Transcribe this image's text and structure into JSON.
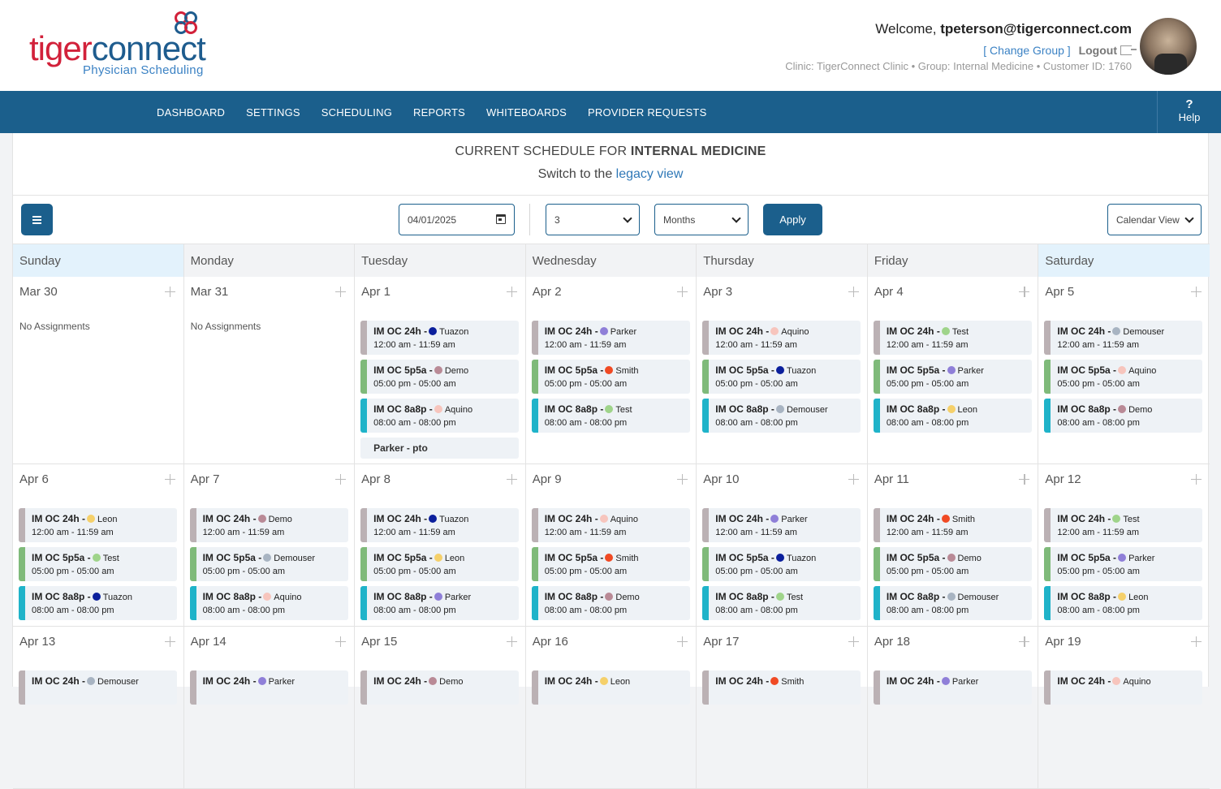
{
  "header": {
    "logo_part1": "tiger",
    "logo_part2": "connect",
    "logo_sub": "Physician Scheduling",
    "welcome_prefix": "Welcome,",
    "user_email": "tpeterson@tigerconnect.com",
    "change_group": "[ Change Group ]",
    "logout": "Logout",
    "clinic_info": "Clinic: TigerConnect Clinic • Group: Internal Medicine • Customer ID: 1760"
  },
  "nav": {
    "items": [
      "DASHBOARD",
      "SETTINGS",
      "SCHEDULING",
      "REPORTS",
      "WHITEBOARDS",
      "PROVIDER REQUESTS"
    ],
    "help_icon": "?",
    "help_label": "Help"
  },
  "page": {
    "title_prefix": "CURRENT SCHEDULE FOR ",
    "title_group": "INTERNAL MEDICINE",
    "switch_prefix": "Switch to the ",
    "switch_link": "legacy view"
  },
  "toolbar": {
    "date_value": "04/01/2025",
    "count_value": "3",
    "unit_value": "Months",
    "apply_label": "Apply",
    "view_value": "Calendar View"
  },
  "colors": {
    "nav": "#1b5f8c",
    "shift24": "#bbb1b4",
    "shift5": "#7fba7a",
    "shift8": "#1fb3c9",
    "Tuazon": "#0b1f9c",
    "Demo": "#b98a96",
    "Aquino": "#f7c5bd",
    "Parker": "#8f7fd8",
    "Smith": "#f04a24",
    "Test": "#9fd48a",
    "Demouser": "#a8b4c2",
    "Leon": "#f5d06a"
  },
  "weekdays": [
    "Sunday",
    "Monday",
    "Tuesday",
    "Wednesday",
    "Thursday",
    "Friday",
    "Saturday"
  ],
  "no_assignments": "No Assignments",
  "weeks": [
    [
      {
        "label": "Mar 30",
        "shifts": []
      },
      {
        "label": "Mar 31",
        "shifts": []
      },
      {
        "label": "Apr 1",
        "shifts": [
          {
            "type": "24",
            "name": "IM OC 24h -",
            "person": "Tuazon",
            "time": "12:00 am - 11:59 am"
          },
          {
            "type": "5",
            "name": "IM OC 5p5a -",
            "person": "Demo",
            "time": "05:00 pm - 05:00 am"
          },
          {
            "type": "8",
            "name": "IM OC 8a8p -",
            "person": "Aquino",
            "time": "08:00 am - 08:00 pm"
          }
        ],
        "pto": "Parker - pto"
      },
      {
        "label": "Apr 2",
        "shifts": [
          {
            "type": "24",
            "name": "IM OC 24h -",
            "person": "Parker",
            "time": "12:00 am - 11:59 am"
          },
          {
            "type": "5",
            "name": "IM OC 5p5a -",
            "person": "Smith",
            "time": "05:00 pm - 05:00 am"
          },
          {
            "type": "8",
            "name": "IM OC 8a8p -",
            "person": "Test",
            "time": "08:00 am - 08:00 pm"
          }
        ]
      },
      {
        "label": "Apr 3",
        "shifts": [
          {
            "type": "24",
            "name": "IM OC 24h -",
            "person": "Aquino",
            "time": "12:00 am - 11:59 am"
          },
          {
            "type": "5",
            "name": "IM OC 5p5a -",
            "person": "Tuazon",
            "time": "05:00 pm - 05:00 am"
          },
          {
            "type": "8",
            "name": "IM OC 8a8p -",
            "person": "Demouser",
            "time": "08:00 am - 08:00 pm"
          }
        ]
      },
      {
        "label": "Apr 4",
        "shifts": [
          {
            "type": "24",
            "name": "IM OC 24h -",
            "person": "Test",
            "time": "12:00 am - 11:59 am"
          },
          {
            "type": "5",
            "name": "IM OC 5p5a -",
            "person": "Parker",
            "time": "05:00 pm - 05:00 am"
          },
          {
            "type": "8",
            "name": "IM OC 8a8p -",
            "person": "Leon",
            "time": "08:00 am - 08:00 pm"
          }
        ]
      },
      {
        "label": "Apr 5",
        "shifts": [
          {
            "type": "24",
            "name": "IM OC 24h -",
            "person": "Demouser",
            "time": "12:00 am - 11:59 am"
          },
          {
            "type": "5",
            "name": "IM OC 5p5a -",
            "person": "Aquino",
            "time": "05:00 pm - 05:00 am"
          },
          {
            "type": "8",
            "name": "IM OC 8a8p -",
            "person": "Demo",
            "time": "08:00 am - 08:00 pm"
          }
        ]
      }
    ],
    [
      {
        "label": "Apr 6",
        "shifts": [
          {
            "type": "24",
            "name": "IM OC 24h -",
            "person": "Leon",
            "time": "12:00 am - 11:59 am"
          },
          {
            "type": "5",
            "name": "IM OC 5p5a -",
            "person": "Test",
            "time": "05:00 pm - 05:00 am"
          },
          {
            "type": "8",
            "name": "IM OC 8a8p -",
            "person": "Tuazon",
            "time": "08:00 am - 08:00 pm"
          }
        ]
      },
      {
        "label": "Apr 7",
        "shifts": [
          {
            "type": "24",
            "name": "IM OC 24h -",
            "person": "Demo",
            "time": "12:00 am - 11:59 am"
          },
          {
            "type": "5",
            "name": "IM OC 5p5a -",
            "person": "Demouser",
            "time": "05:00 pm - 05:00 am"
          },
          {
            "type": "8",
            "name": "IM OC 8a8p -",
            "person": "Aquino",
            "time": "08:00 am - 08:00 pm"
          }
        ]
      },
      {
        "label": "Apr 8",
        "shifts": [
          {
            "type": "24",
            "name": "IM OC 24h -",
            "person": "Tuazon",
            "time": "12:00 am - 11:59 am"
          },
          {
            "type": "5",
            "name": "IM OC 5p5a -",
            "person": "Leon",
            "time": "05:00 pm - 05:00 am"
          },
          {
            "type": "8",
            "name": "IM OC 8a8p -",
            "person": "Parker",
            "time": "08:00 am - 08:00 pm"
          }
        ]
      },
      {
        "label": "Apr 9",
        "shifts": [
          {
            "type": "24",
            "name": "IM OC 24h -",
            "person": "Aquino",
            "time": "12:00 am - 11:59 am"
          },
          {
            "type": "5",
            "name": "IM OC 5p5a -",
            "person": "Smith",
            "time": "05:00 pm - 05:00 am"
          },
          {
            "type": "8",
            "name": "IM OC 8a8p -",
            "person": "Demo",
            "time": "08:00 am - 08:00 pm"
          }
        ]
      },
      {
        "label": "Apr 10",
        "shifts": [
          {
            "type": "24",
            "name": "IM OC 24h -",
            "person": "Parker",
            "time": "12:00 am - 11:59 am"
          },
          {
            "type": "5",
            "name": "IM OC 5p5a -",
            "person": "Tuazon",
            "time": "05:00 pm - 05:00 am"
          },
          {
            "type": "8",
            "name": "IM OC 8a8p -",
            "person": "Test",
            "time": "08:00 am - 08:00 pm"
          }
        ]
      },
      {
        "label": "Apr 11",
        "shifts": [
          {
            "type": "24",
            "name": "IM OC 24h -",
            "person": "Smith",
            "time": "12:00 am - 11:59 am"
          },
          {
            "type": "5",
            "name": "IM OC 5p5a -",
            "person": "Demo",
            "time": "05:00 pm - 05:00 am"
          },
          {
            "type": "8",
            "name": "IM OC 8a8p -",
            "person": "Demouser",
            "time": "08:00 am - 08:00 pm"
          }
        ]
      },
      {
        "label": "Apr 12",
        "shifts": [
          {
            "type": "24",
            "name": "IM OC 24h -",
            "person": "Test",
            "time": "12:00 am - 11:59 am"
          },
          {
            "type": "5",
            "name": "IM OC 5p5a -",
            "person": "Parker",
            "time": "05:00 pm - 05:00 am"
          },
          {
            "type": "8",
            "name": "IM OC 8a8p -",
            "person": "Leon",
            "time": "08:00 am - 08:00 pm"
          }
        ]
      }
    ],
    [
      {
        "label": "Apr 13",
        "shifts": [
          {
            "type": "24",
            "name": "IM OC 24h -",
            "person": "Demouser",
            "time": ""
          }
        ]
      },
      {
        "label": "Apr 14",
        "shifts": [
          {
            "type": "24",
            "name": "IM OC 24h -",
            "person": "Parker",
            "time": ""
          }
        ]
      },
      {
        "label": "Apr 15",
        "shifts": [
          {
            "type": "24",
            "name": "IM OC 24h -",
            "person": "Demo",
            "time": ""
          }
        ]
      },
      {
        "label": "Apr 16",
        "shifts": [
          {
            "type": "24",
            "name": "IM OC 24h -",
            "person": "Leon",
            "time": ""
          }
        ]
      },
      {
        "label": "Apr 17",
        "shifts": [
          {
            "type": "24",
            "name": "IM OC 24h -",
            "person": "Smith",
            "time": ""
          }
        ]
      },
      {
        "label": "Apr 18",
        "shifts": [
          {
            "type": "24",
            "name": "IM OC 24h -",
            "person": "Parker",
            "time": ""
          }
        ]
      },
      {
        "label": "Apr 19",
        "shifts": [
          {
            "type": "24",
            "name": "IM OC 24h -",
            "person": "Aquino",
            "time": ""
          }
        ]
      }
    ]
  ]
}
